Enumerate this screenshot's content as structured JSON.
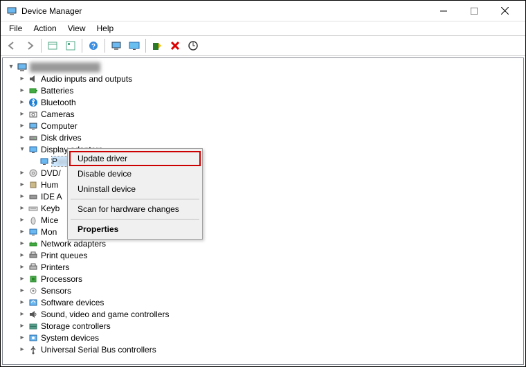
{
  "window": {
    "title": "Device Manager"
  },
  "menubar": {
    "items": [
      "File",
      "Action",
      "View",
      "Help"
    ]
  },
  "toolbar": {
    "icons": [
      "back-icon",
      "forward-icon",
      "sep",
      "show-hidden-icon",
      "properties-icon",
      "sep",
      "help-icon",
      "sep",
      "computer-icon",
      "monitor-icon",
      "sep",
      "update-driver-icon",
      "close-red-icon",
      "scan-hardware-icon"
    ]
  },
  "tree": {
    "root": {
      "label": "",
      "blurred": true,
      "icon": "computer"
    },
    "items": [
      {
        "label": "Audio inputs and outputs",
        "icon": "audio",
        "expandable": true
      },
      {
        "label": "Batteries",
        "icon": "battery",
        "expandable": true
      },
      {
        "label": "Bluetooth",
        "icon": "bluetooth",
        "expandable": true
      },
      {
        "label": "Cameras",
        "icon": "camera",
        "expandable": true
      },
      {
        "label": "Computer",
        "icon": "computer-node",
        "expandable": true
      },
      {
        "label": "Disk drives",
        "icon": "disk",
        "expandable": true
      },
      {
        "label": "Display adapters",
        "icon": "display",
        "expandable": true,
        "expanded": true,
        "children": [
          {
            "label": "",
            "icon": "display",
            "selected": true,
            "blurred": true
          }
        ]
      },
      {
        "label": "DVD/",
        "truncated": true,
        "icon": "dvd",
        "expandable": true
      },
      {
        "label": "Hum",
        "truncated": true,
        "icon": "hid",
        "expandable": true
      },
      {
        "label": "IDE A",
        "truncated": true,
        "icon": "ide",
        "expandable": true
      },
      {
        "label": "Keyb",
        "truncated": true,
        "icon": "keyboard",
        "expandable": true
      },
      {
        "label": "Mice",
        "truncated": true,
        "icon": "mouse",
        "expandable": true
      },
      {
        "label": "Mon",
        "truncated": true,
        "icon": "monitor",
        "expandable": true
      },
      {
        "label": "Network adapters",
        "icon": "network",
        "expandable": true
      },
      {
        "label": "Print queues",
        "icon": "printqueue",
        "expandable": true
      },
      {
        "label": "Printers",
        "icon": "printer",
        "expandable": true
      },
      {
        "label": "Processors",
        "icon": "cpu",
        "expandable": true
      },
      {
        "label": "Sensors",
        "icon": "sensor",
        "expandable": true
      },
      {
        "label": "Software devices",
        "icon": "software",
        "expandable": true
      },
      {
        "label": "Sound, video and game controllers",
        "icon": "sound",
        "expandable": true
      },
      {
        "label": "Storage controllers",
        "icon": "storage",
        "expandable": true
      },
      {
        "label": "System devices",
        "icon": "system",
        "expandable": true
      },
      {
        "label": "Universal Serial Bus controllers",
        "icon": "usb",
        "expandable": true
      }
    ]
  },
  "contextmenu": {
    "items": [
      {
        "label": "Update driver",
        "highlighted": true
      },
      {
        "label": "Disable device"
      },
      {
        "label": "Uninstall device"
      },
      {
        "sep": true
      },
      {
        "label": "Scan for hardware changes"
      },
      {
        "sep": true
      },
      {
        "label": "Properties",
        "bold": true
      }
    ]
  }
}
